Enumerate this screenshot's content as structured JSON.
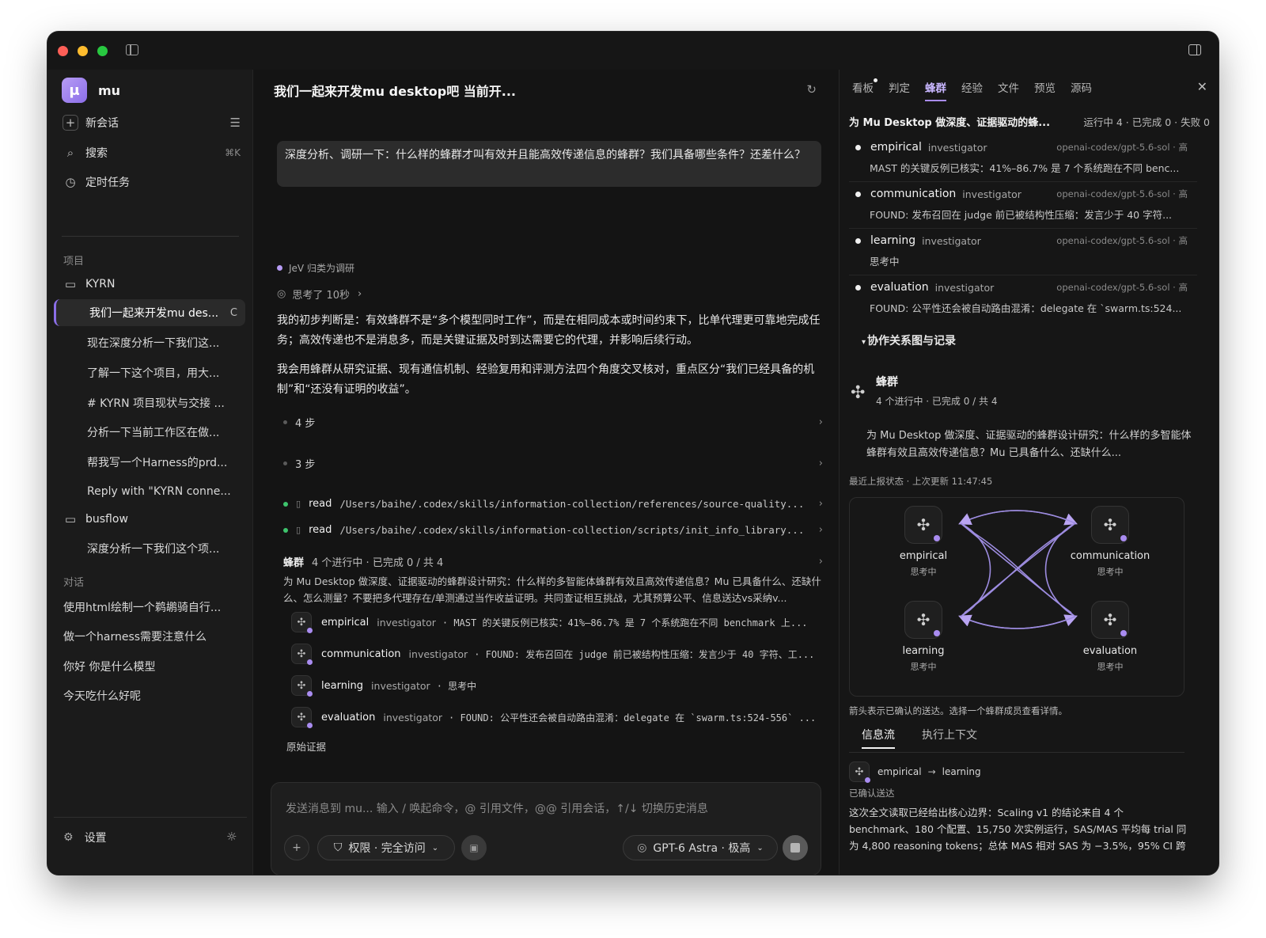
{
  "sidebar": {
    "brand_name": "mu",
    "new_chat": "新会话",
    "search": "搜索",
    "search_shortcut": "⌘K",
    "scheduled": "定时任务",
    "projects_label": "项目",
    "projects": [
      {
        "name": "KYRN",
        "threads": [
          "我们一起来开发mu des...",
          "现在深度分析一下我们这...",
          "了解一下这个项目，用大...",
          "# KYRN 项目现状与交接 ...",
          "分析一下当前工作区在做...",
          "帮我写一个Harness的prd...",
          "Reply with \"KYRN conne..."
        ]
      },
      {
        "name": "busflow",
        "threads": [
          "深度分析一下我们这个项..."
        ]
      }
    ],
    "chats_label": "对话",
    "chats": [
      "使用html绘制一个鹈鹕骑自行...",
      "做一个harness需要注意什么",
      "你好 你是什么模型",
      "今天吃什么好呢"
    ],
    "settings": "设置"
  },
  "main": {
    "title": "我们一起来开发mu desktop吧 当前开...",
    "user_message": "深度分析、调研一下：什么样的蜂群才叫有效并且能高效传递信息的蜂群？我们具备哪些条件？还差什么？",
    "classify": "JeV 归类为调研",
    "thought": "思考了 10秒",
    "para1": "我的初步判断是：有效蜂群不是“多个模型同时工作”，而是在相同成本或时间约束下，比单代理更可靠地完成任务；高效传递也不是消息多，而是关键证据及时到达需要它的代理，并影响后续行动。",
    "para2": "我会用蜂群从研究证据、现有通信机制、经验复用和评测方法四个角度交叉核对，重点区分“我们已经具备的机制”和“还没有证明的收益”。",
    "steps": [
      "4 步",
      "3 步"
    ],
    "reads": [
      {
        "kw": "read",
        "path": "/Users/baihe/.codex/skills/information-collection/references/source-quality..."
      },
      {
        "kw": "read",
        "path": "/Users/baihe/.codex/skills/information-collection/scripts/init_info_library..."
      }
    ],
    "swarm_label": "蜂群",
    "swarm_status": "4 个进行中 · 已完成 0 / 共 4",
    "swarm_desc": "为 Mu Desktop 做深度、证据驱动的蜂群设计研究：什么样的多智能体蜂群有效且高效传递信息？Mu 已具备什么、还缺什么、怎么测量？不要把多代理存在/单测通过当作收益证明。共同查证相互挑战，尤其预算公平、信息送达vs采纳v...",
    "agents": [
      {
        "name": "empirical",
        "role": "investigator",
        "msg": "· MAST 的关键反例已核实：41%–86.7% 是 7 个系统跑在不同 benchmark 上..."
      },
      {
        "name": "communication",
        "role": "investigator",
        "msg": "· FOUND: 发布召回在 judge 前已被结构性压缩：发言少于 40 字符、工..."
      },
      {
        "name": "learning",
        "role": "investigator",
        "msg": "· 思考中"
      },
      {
        "name": "evaluation",
        "role": "investigator",
        "msg": "· FOUND: 公平性还会被自动路由混淆：delegate 在 `swarm.ts:524-556` ..."
      }
    ],
    "raw_evidence": "原始证据",
    "composer_placeholder": "发送消息到 mu... 输入 / 唤起命令，@ 引用文件，@@ 引用会话，↑/↓ 切换历史消息",
    "permission": "权限 · 完全访问",
    "model": "GPT-6 Astra · 极高"
  },
  "right": {
    "tabs": [
      "看板",
      "判定",
      "蜂群",
      "经验",
      "文件",
      "预览",
      "源码"
    ],
    "active_tab": 2,
    "title": "为 Mu Desktop 做深度、证据驱动的蜂...",
    "status": "运行中 4 · 已完成 0 · 失败 0",
    "agents": [
      {
        "name": "empirical",
        "role": "investigator",
        "model": "openai-codex/gpt-5.6-sol · 高",
        "msg": "MAST 的关键反例已核实：41%–86.7% 是 7 个系统跑在不同 benc..."
      },
      {
        "name": "communication",
        "role": "investigator",
        "model": "openai-codex/gpt-5.6-sol · 高",
        "msg": "FOUND: 发布召回在 judge 前已被结构性压缩：发言少于 40 字符..."
      },
      {
        "name": "learning",
        "role": "investigator",
        "model": "openai-codex/gpt-5.6-sol · 高",
        "msg": "思考中"
      },
      {
        "name": "evaluation",
        "role": "investigator",
        "model": "openai-codex/gpt-5.6-sol · 高",
        "msg": "FOUND: 公平性还会被自动路由混淆：delegate 在 `swarm.ts:524..."
      }
    ],
    "collab": "协作关系图与记录",
    "swarm_name": "蜂群",
    "swarm_sub": "4 个进行中 · 已完成 0 / 共 4",
    "swarm_goal": "为 Mu Desktop 做深度、证据驱动的蜂群设计研究：什么样的多智能体蜂群有效且高效传递信息？Mu 已具备什么、还缺什么...",
    "last_status": "最近上报状态 · 上次更新 11:47:45",
    "graph_nodes": [
      {
        "name": "empirical",
        "status": "思考中"
      },
      {
        "name": "communication",
        "status": "思考中"
      },
      {
        "name": "learning",
        "status": "思考中"
      },
      {
        "name": "evaluation",
        "status": "思考中"
      }
    ],
    "graph_note": "箭头表示已确认的送达。选择一个蜂群成员查看详情。",
    "flow_tabs": [
      "信息流",
      "执行上下文"
    ],
    "flow_from": "empirical",
    "flow_to": "learning",
    "flow_confirm": "已确认送达",
    "flow_text": "这次全文读取已经给出核心边界：Scaling v1 的结论来自 4 个 benchmark、180 个配置、15,750 次实例运行，SAS/MAS 平均每 trial 同为 4,800 reasoning tokens；总体 MAS 相对 SAS 为 −3.5%，95% CI 跨"
  },
  "colors": {
    "accent": "#a98cf0",
    "status_green": "#3ec46d",
    "background": "#161616"
  }
}
